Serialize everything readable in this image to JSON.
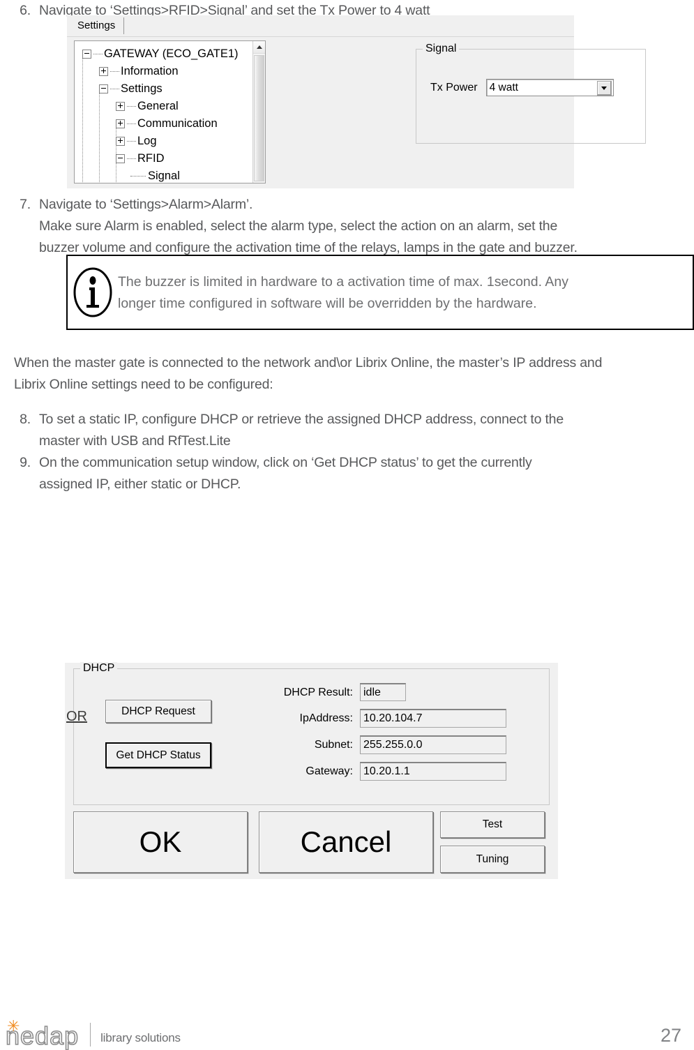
{
  "document": {
    "page_number": "27"
  },
  "steps": [
    {
      "number": "6.",
      "text": "Navigate to ‘Settings>RFID>Signal’ and set the Tx Power to 4 watt"
    },
    {
      "number": "7.",
      "line1": "Navigate to ‘Settings>Alarm>Alarm’.",
      "line2": "Make sure Alarm is enabled, select the alarm type, select the action on an alarm, set the",
      "line3": "buzzer volume and configure the activation time of the relays, lamps in the gate and buzzer."
    },
    {
      "number": "8.",
      "line1": "To set a static IP, configure DHCP or retrieve the assigned DHCP address, connect to the",
      "line2": "master with USB and RfTest.Lite"
    },
    {
      "number": "9.",
      "line1": "On the communication setup window, click on ‘Get DHCP status’ to get the currently",
      "line2": "assigned IP, either static or DHCP."
    }
  ],
  "note": {
    "icon": "info-icon",
    "line1": "The buzzer is limited in hardware to a activation time of max. 1second. Any",
    "line2": "longer time configured in software will be overridden by the hardware."
  },
  "paragraph": {
    "line1": "When the master gate is connected to the network and\\or Librix Online, the master’s IP address and",
    "line2": "Librix Online settings need to be configured:"
  },
  "settings_screenshot": {
    "tab_label": "Settings",
    "tree": [
      {
        "label": "GATEWAY (ECO_GATE1)",
        "state": "expanded",
        "depth": 0
      },
      {
        "label": "Information",
        "state": "collapsed",
        "depth": 1
      },
      {
        "label": "Settings",
        "state": "expanded",
        "depth": 1
      },
      {
        "label": "General",
        "state": "collapsed",
        "depth": 2
      },
      {
        "label": "Communication",
        "state": "collapsed",
        "depth": 2
      },
      {
        "label": "Log",
        "state": "collapsed",
        "depth": 2
      },
      {
        "label": "RFID",
        "state": "expanded",
        "depth": 2
      },
      {
        "label": "Signal",
        "state": "leaf",
        "depth": 3
      }
    ],
    "signal_group": {
      "title": "Signal",
      "tx_power_label": "Tx Power",
      "tx_power_value": "4 watt"
    }
  },
  "dhcp_screenshot": {
    "group_title": "DHCP",
    "buttons": {
      "dhcp_request": "DHCP Request",
      "get_dhcp_status": "Get DHCP Status",
      "ok": "OK",
      "cancel": "Cancel",
      "test": "Test",
      "tuning": "Tuning"
    },
    "fields": [
      {
        "label": "DHCP Result:",
        "value": "idle"
      },
      {
        "label": "IpAddress:",
        "value": "10.20.104.7"
      },
      {
        "label": "Subnet:",
        "value": "255.255.0.0"
      },
      {
        "label": "Gateway:",
        "value": "10.20.1.1"
      }
    ]
  },
  "or_label": "OR",
  "footer": {
    "brand": "nedap",
    "tagline": "library solutions",
    "star_glyph": "✳",
    "accent_color": "#f08a1e"
  }
}
